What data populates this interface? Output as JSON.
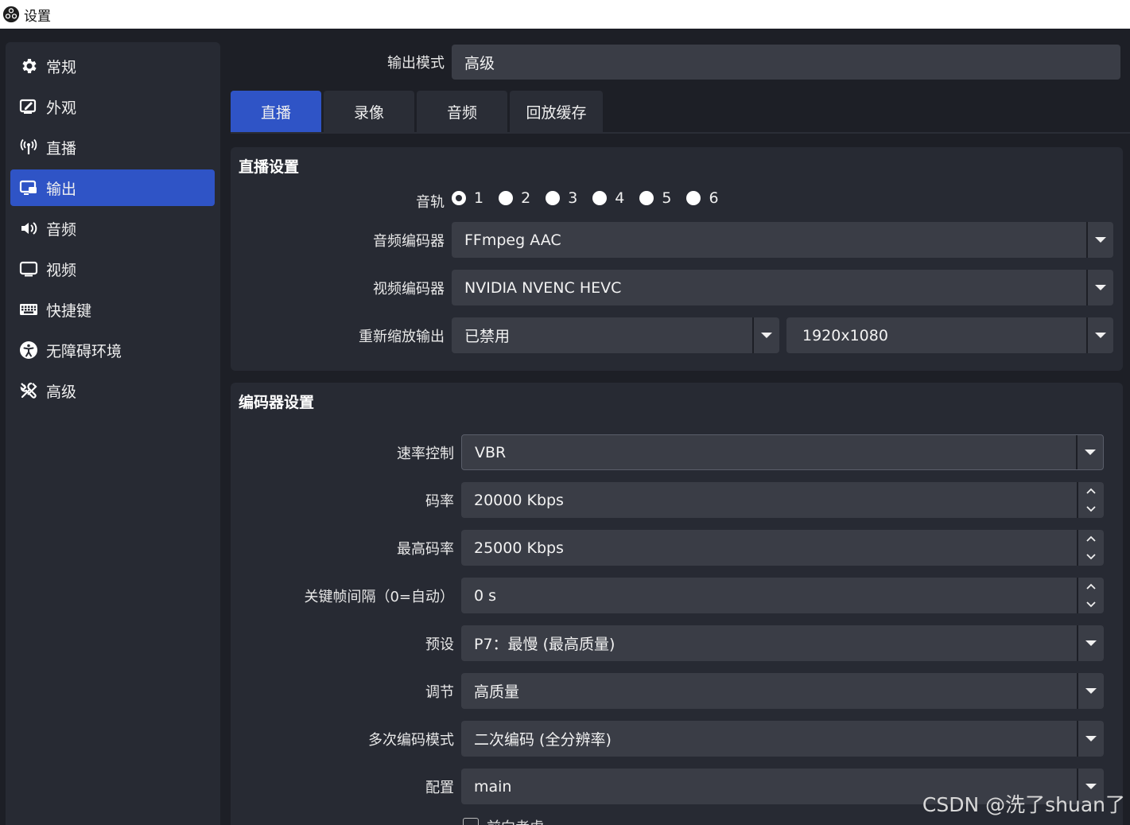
{
  "window": {
    "title": "设置"
  },
  "sidebar": {
    "items": [
      {
        "label": "常规",
        "icon": "gear-icon"
      },
      {
        "label": "外观",
        "icon": "appearance-icon"
      },
      {
        "label": "直播",
        "icon": "antenna-icon"
      },
      {
        "label": "输出",
        "icon": "output-icon",
        "active": true
      },
      {
        "label": "音频",
        "icon": "speaker-icon"
      },
      {
        "label": "视频",
        "icon": "monitor-icon"
      },
      {
        "label": "快捷键",
        "icon": "keyboard-icon"
      },
      {
        "label": "无障碍环境",
        "icon": "accessibility-icon"
      },
      {
        "label": "高级",
        "icon": "tools-icon"
      }
    ]
  },
  "output_mode": {
    "label": "输出模式",
    "value": "高级"
  },
  "tabs": [
    {
      "label": "直播",
      "active": true
    },
    {
      "label": "录像"
    },
    {
      "label": "音频"
    },
    {
      "label": "回放缓存"
    }
  ],
  "stream_settings": {
    "title": "直播设置",
    "audio_track": {
      "label": "音轨",
      "options": [
        "1",
        "2",
        "3",
        "4",
        "5",
        "6"
      ],
      "selected": "1"
    },
    "audio_encoder": {
      "label": "音频编码器",
      "value": "FFmpeg AAC"
    },
    "video_encoder": {
      "label": "视频编码器",
      "value": "NVIDIA NVENC HEVC"
    },
    "rescale": {
      "label": "重新缩放输出",
      "value": "已禁用",
      "resolution": "1920x1080"
    }
  },
  "encoder_settings": {
    "title": "编码器设置",
    "rate_control": {
      "label": "速率控制",
      "value": "VBR"
    },
    "bitrate": {
      "label": "码率",
      "value": "20000 Kbps"
    },
    "max_bitrate": {
      "label": "最高码率",
      "value": "25000 Kbps"
    },
    "keyframe_interval": {
      "label": "关键帧间隔（0=自动）",
      "value": "0 s"
    },
    "preset": {
      "label": "预设",
      "value": "P7：最慢 (最高质量)"
    },
    "tuning": {
      "label": "调节",
      "value": "高质量"
    },
    "multipass": {
      "label": "多次编码模式",
      "value": "二次编码 (全分辨率)"
    },
    "profile": {
      "label": "配置",
      "value": "main"
    },
    "psycho_visual": {
      "label": "前向考虑"
    }
  },
  "watermark": "CSDN @洗了shuan了",
  "colors": {
    "accent": "#2f54c6",
    "background": "#1d1f26",
    "panel": "#272a33",
    "field": "#3a3d46"
  }
}
